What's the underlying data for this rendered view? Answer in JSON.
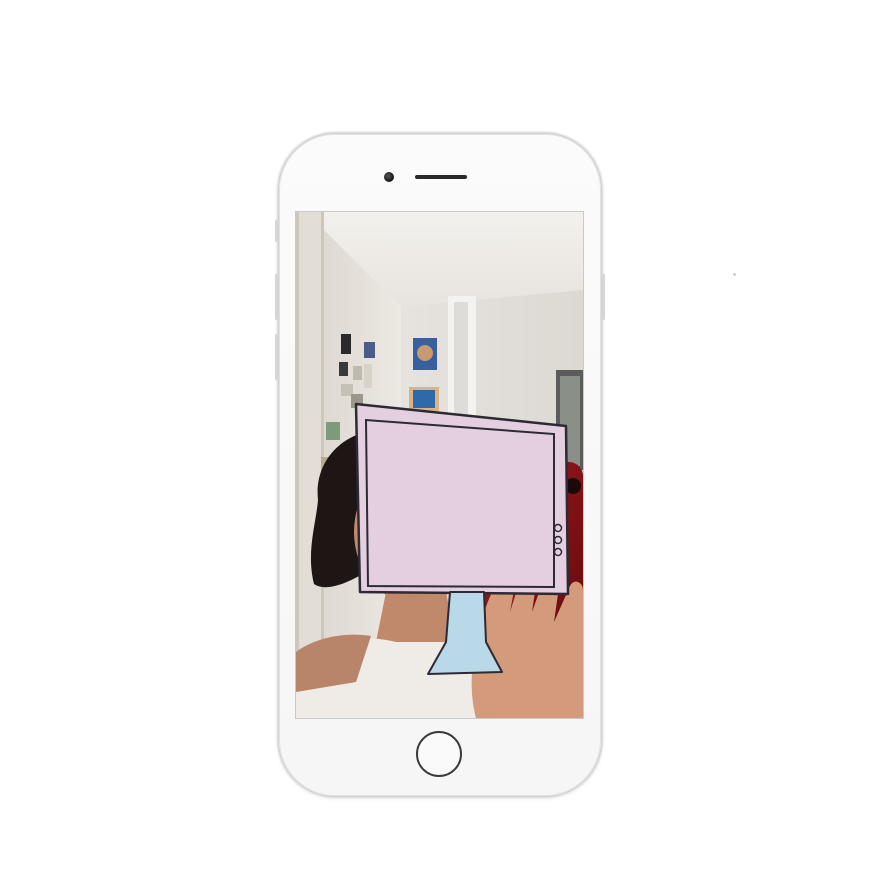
{
  "device": {
    "model_icon": "iphone-silver-icon",
    "body_color": "#f8f8f8",
    "frame_color": "#d3d3d3"
  },
  "screen": {
    "content": "front-camera-selfie-with-ar-sticker",
    "sticker": {
      "icon": "retro-tv-monitor-icon",
      "frame_color": "#e4cfe0",
      "outline_color": "#2d2a33",
      "stand_color": "#b9d8e8",
      "knob_count": 3
    }
  },
  "controls": {
    "home_button_icon": "home-button-icon",
    "camera_icon": "front-camera-icon",
    "speaker_icon": "earpiece-icon"
  }
}
